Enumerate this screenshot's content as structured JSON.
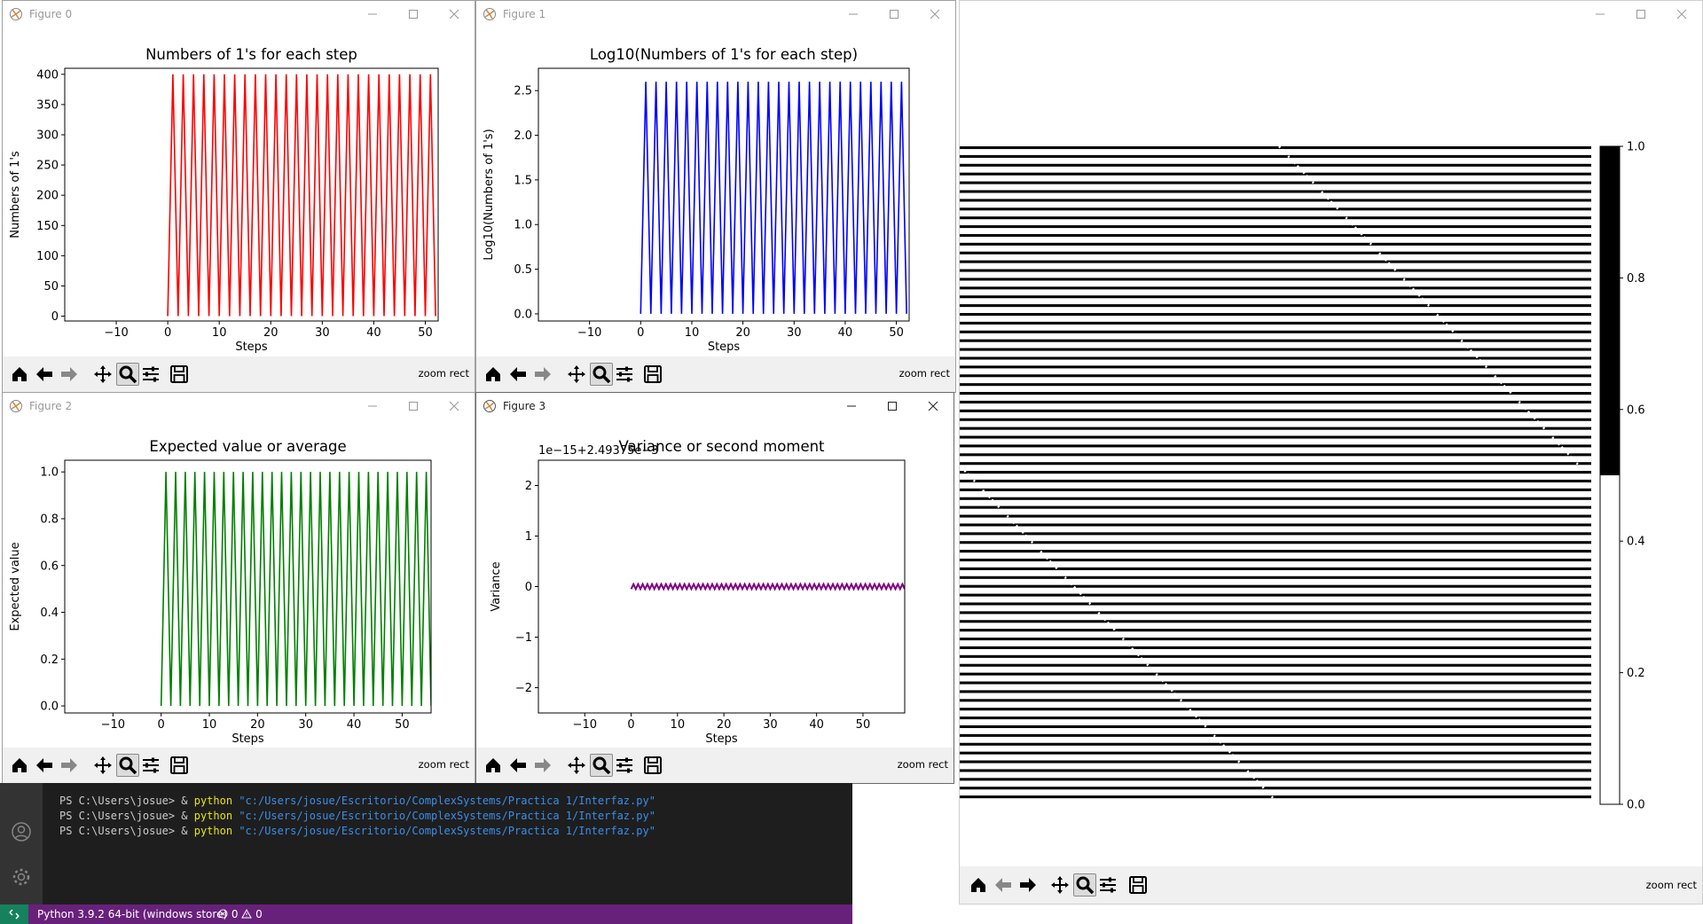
{
  "colors": {
    "red": "#ff0000",
    "blue": "#0000ff",
    "green": "#008000",
    "purple": "#800080",
    "statusbar": "#68217a",
    "remote": "#16825d"
  },
  "windows": {
    "fig0": {
      "title": "Figure 0",
      "zoom": "zoom rect"
    },
    "fig1": {
      "title": "Figure 1",
      "zoom": "zoom rect"
    },
    "fig2": {
      "title": "Figure 2",
      "zoom": "zoom rect"
    },
    "fig3": {
      "title": "Figure 3",
      "zoom": "zoom rect"
    },
    "fig4": {
      "title": "",
      "zoom": "zoom rect"
    }
  },
  "toolbar_icons": [
    "home-icon",
    "back-arrow-icon",
    "forward-arrow-icon",
    "pan-icon",
    "zoom-icon",
    "configure-subplots-icon",
    "save-icon"
  ],
  "terminal": {
    "lines": [
      {
        "prompt": "PS C:\\Users\\josue> & ",
        "cmd": "python",
        "arg": "\"c:/Users/josue/Escritorio/ComplexSystems/Practica 1/Interfaz.py\""
      },
      {
        "prompt": "PS C:\\Users\\josue> & ",
        "cmd": "python",
        "arg": "\"c:/Users/josue/Escritorio/ComplexSystems/Practica 1/Interfaz.py\""
      },
      {
        "prompt": "PS C:\\Users\\josue> & ",
        "cmd": "python",
        "arg": "\"c:/Users/josue/Escritorio/ComplexSystems/Practica 1/Interfaz.py\""
      }
    ]
  },
  "statusbar": {
    "python": "Python 3.9.2 64-bit (windows store)",
    "errors": "0",
    "warnings": "0"
  },
  "chart_data": [
    {
      "id": "fig0",
      "type": "line",
      "title": "Numbers of 1's for each step",
      "xlabel": "Steps",
      "ylabel": "Numbers of 1's",
      "xlim": [
        -20,
        52.5
      ],
      "ylim": [
        -8,
        410
      ],
      "xticks": [
        -10,
        0,
        10,
        20,
        30,
        40,
        50
      ],
      "yticks": [
        0,
        50,
        100,
        150,
        200,
        250,
        300,
        350,
        400
      ],
      "ytick_labels": [
        "0",
        "50",
        "100",
        "150",
        "200",
        "250",
        "300",
        "350",
        "400"
      ],
      "color": "#ff0000",
      "series": [
        {
          "pattern": "alternating",
          "start": 0,
          "end": 52,
          "low": 0,
          "high": 400
        }
      ]
    },
    {
      "id": "fig1",
      "type": "line",
      "title": "Log10(Numbers of 1's for each step)",
      "xlabel": "Steps",
      "ylabel": "Log10(Numbers of 1's)",
      "xlim": [
        -20,
        52.5
      ],
      "ylim": [
        -0.08,
        2.75
      ],
      "xticks": [
        -10,
        0,
        10,
        20,
        30,
        40,
        50
      ],
      "yticks": [
        0,
        0.5,
        1.0,
        1.5,
        2.0,
        2.5
      ],
      "ytick_labels": [
        "0.0",
        "0.5",
        "1.0",
        "1.5",
        "2.0",
        "2.5"
      ],
      "color": "#0000ff",
      "series": [
        {
          "pattern": "alternating",
          "start": 0,
          "end": 52,
          "low": 0,
          "high": 2.6
        }
      ]
    },
    {
      "id": "fig2",
      "type": "line",
      "title": "Expected value or average",
      "xlabel": "Steps",
      "ylabel": "Expected value",
      "xlim": [
        -20,
        56
      ],
      "ylim": [
        -0.03,
        1.05
      ],
      "xticks": [
        -10,
        0,
        10,
        20,
        30,
        40,
        50
      ],
      "yticks": [
        0,
        0.2,
        0.4,
        0.6,
        0.8,
        1.0
      ],
      "ytick_labels": [
        "0.0",
        "0.2",
        "0.4",
        "0.6",
        "0.8",
        "1.0"
      ],
      "color": "#008000",
      "series": [
        {
          "pattern": "alternating",
          "start": 0,
          "end": 56,
          "low": 0,
          "high": 1.0
        }
      ]
    },
    {
      "id": "fig3",
      "type": "line",
      "title": "Variance or second moment",
      "xlabel": "Steps",
      "ylabel": "Variance",
      "offset_text": "1e−15+2.49375e−3",
      "xlim": [
        -20,
        59
      ],
      "ylim": [
        -2.5,
        2.5
      ],
      "xticks": [
        -10,
        0,
        10,
        20,
        30,
        40,
        50
      ],
      "yticks": [
        -2,
        -1,
        0,
        1,
        2
      ],
      "ytick_labels": [
        "−2",
        "−1",
        "0",
        "1",
        "2"
      ],
      "color": "#800080",
      "series": [
        {
          "pattern": "wave",
          "start": 0,
          "end": 59,
          "low": -0.05,
          "high": 0.05
        }
      ]
    },
    {
      "id": "fig4",
      "type": "heatmap",
      "colorbar_ticks": [
        0.0,
        0.2,
        0.4,
        0.6,
        0.8,
        1.0
      ],
      "colorbar_labels": [
        "0.0",
        "0.2",
        "0.4",
        "0.6",
        "0.8",
        "1.0"
      ],
      "clim": [
        0,
        1
      ],
      "description_rows": "alternating black and white rows with diagonal band"
    }
  ]
}
